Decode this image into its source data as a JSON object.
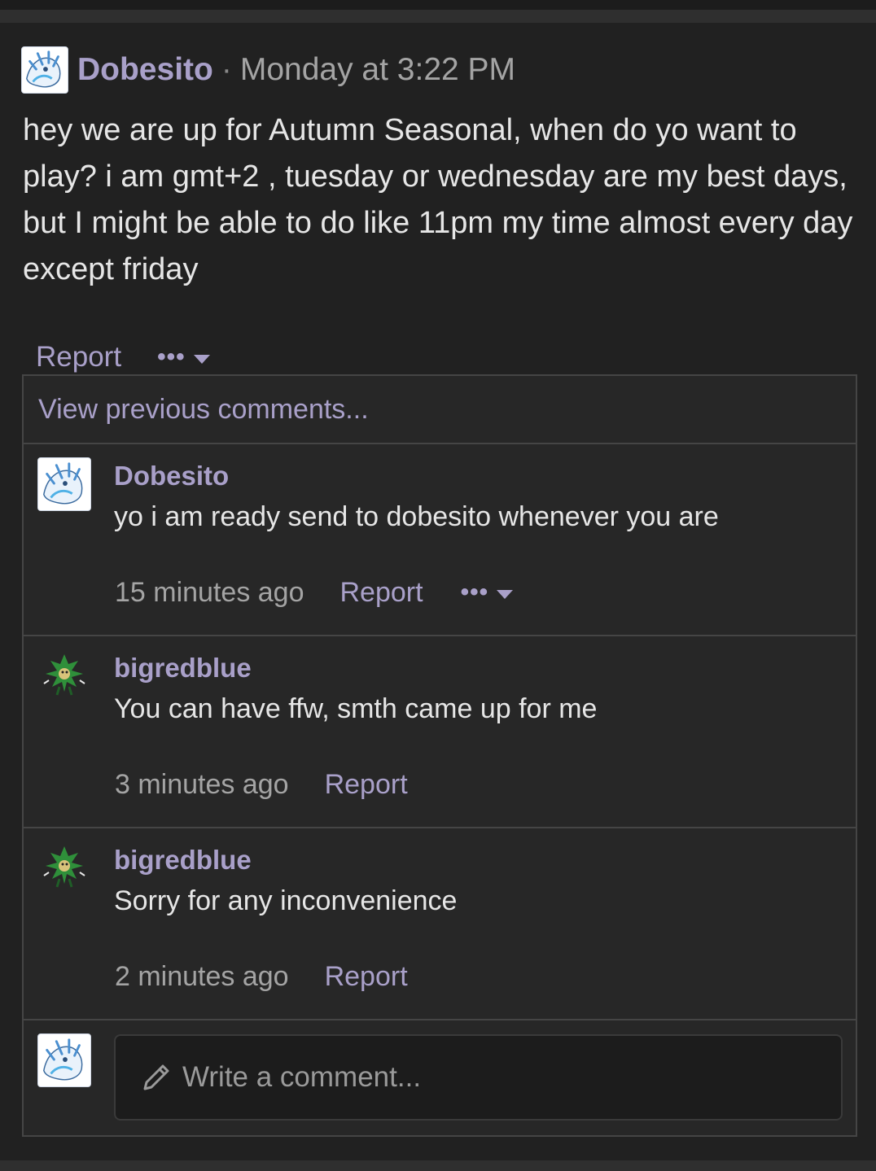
{
  "post": {
    "author": "Dobesito",
    "separator": "·",
    "timestamp": "Monday at 3:22 PM",
    "body": "hey we are up for Autumn Seasonal, when do yo want to play? i am gmt+2 , tuesday or wednesday are my best days, but I might be able to do like 11pm my time almost every day except friday",
    "report_label": "Report",
    "more_label": "•••"
  },
  "comments_section": {
    "view_previous_label": "View previous comments...",
    "items": [
      {
        "author": "Dobesito",
        "text": "yo i am ready send to dobesito whenever you are",
        "time": "15 minutes ago",
        "report_label": "Report",
        "more_label": "•••",
        "avatar_icon": "white-fox-avatar-icon"
      },
      {
        "author": "bigredblue",
        "text": "You can have ffw, smth came up for me",
        "time": "3 minutes ago",
        "report_label": "Report",
        "avatar_icon": "green-sprite-avatar-icon"
      },
      {
        "author": "bigredblue",
        "text": "Sorry for any inconvenience",
        "time": "2 minutes ago",
        "report_label": "Report",
        "avatar_icon": "green-sprite-avatar-icon"
      }
    ],
    "write_placeholder": "Write a comment..."
  },
  "colors": {
    "background": "#212121",
    "accent_link": "#a9a0c9",
    "text": "#e6e6e6",
    "muted": "#a4a4a4"
  }
}
